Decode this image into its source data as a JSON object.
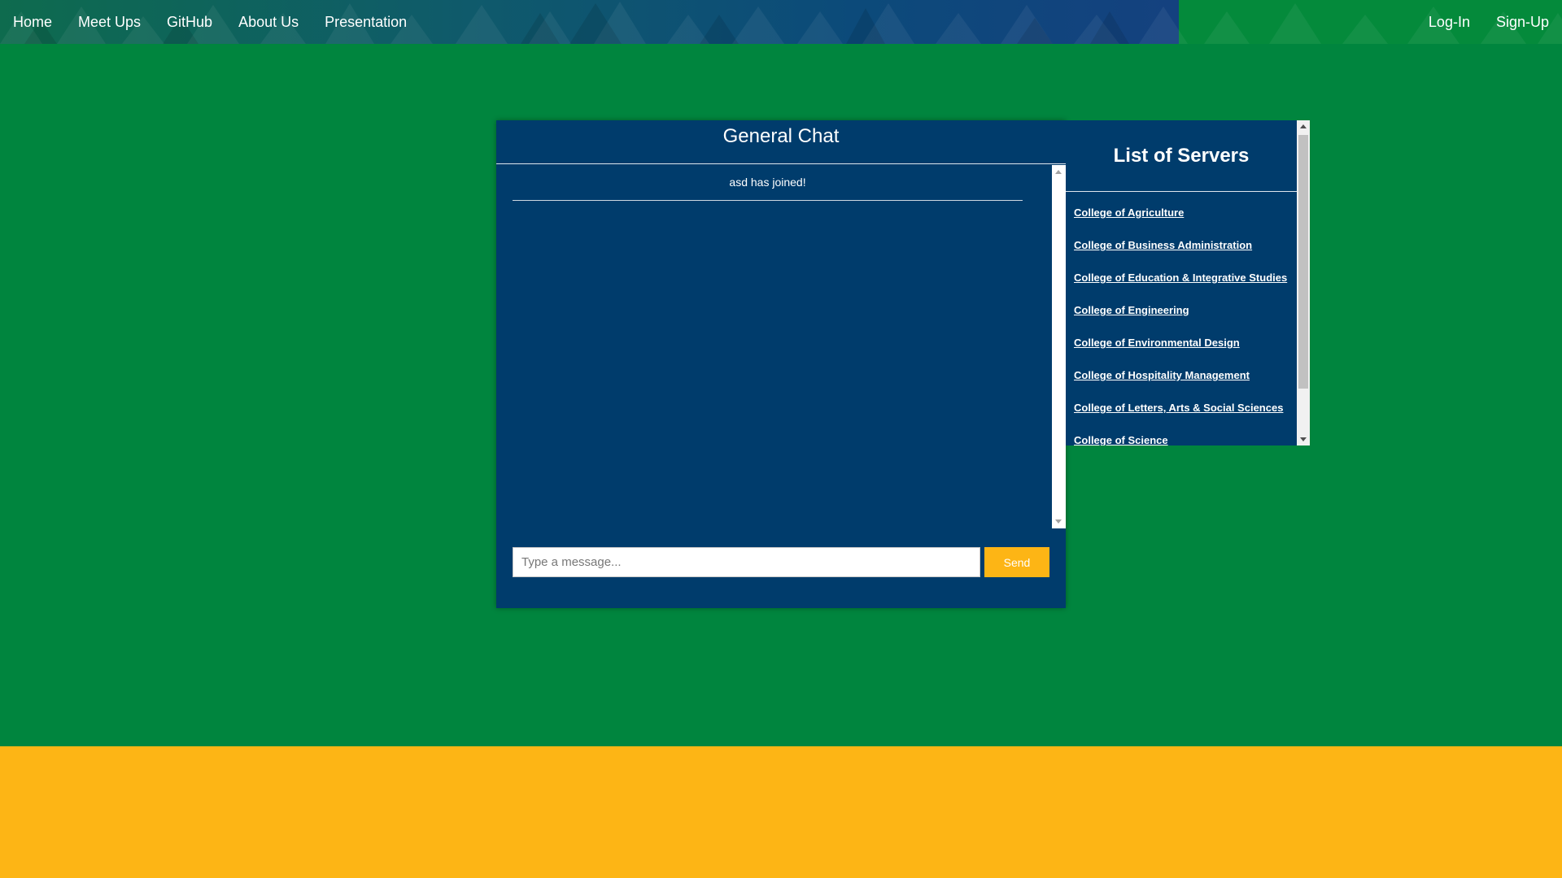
{
  "nav": {
    "left": [
      {
        "label": "Home"
      },
      {
        "label": "Meet Ups"
      },
      {
        "label": "GitHub"
      },
      {
        "label": "About Us"
      },
      {
        "label": "Presentation"
      }
    ],
    "right": [
      {
        "label": "Log-In"
      },
      {
        "label": "Sign-Up"
      }
    ]
  },
  "chat": {
    "title": "General Chat",
    "messages": [
      {
        "text": "asd has joined!"
      }
    ],
    "input_placeholder": "Type a message...",
    "input_value": "",
    "send_label": "Send"
  },
  "servers": {
    "title": "List of Servers",
    "items": [
      {
        "label": "College of Agriculture"
      },
      {
        "label": "College of Business Administration"
      },
      {
        "label": "College of Education & Integrative Studies"
      },
      {
        "label": "College of Engineering"
      },
      {
        "label": "College of Environmental Design"
      },
      {
        "label": "College of Hospitality Management"
      },
      {
        "label": "College of Letters, Arts & Social Sciences"
      },
      {
        "label": "College of Science"
      }
    ]
  },
  "colors": {
    "page_background": "#00853e",
    "panel_background": "#003c6c",
    "accent_gold": "#fdb515",
    "text_light": "#ffffff"
  }
}
